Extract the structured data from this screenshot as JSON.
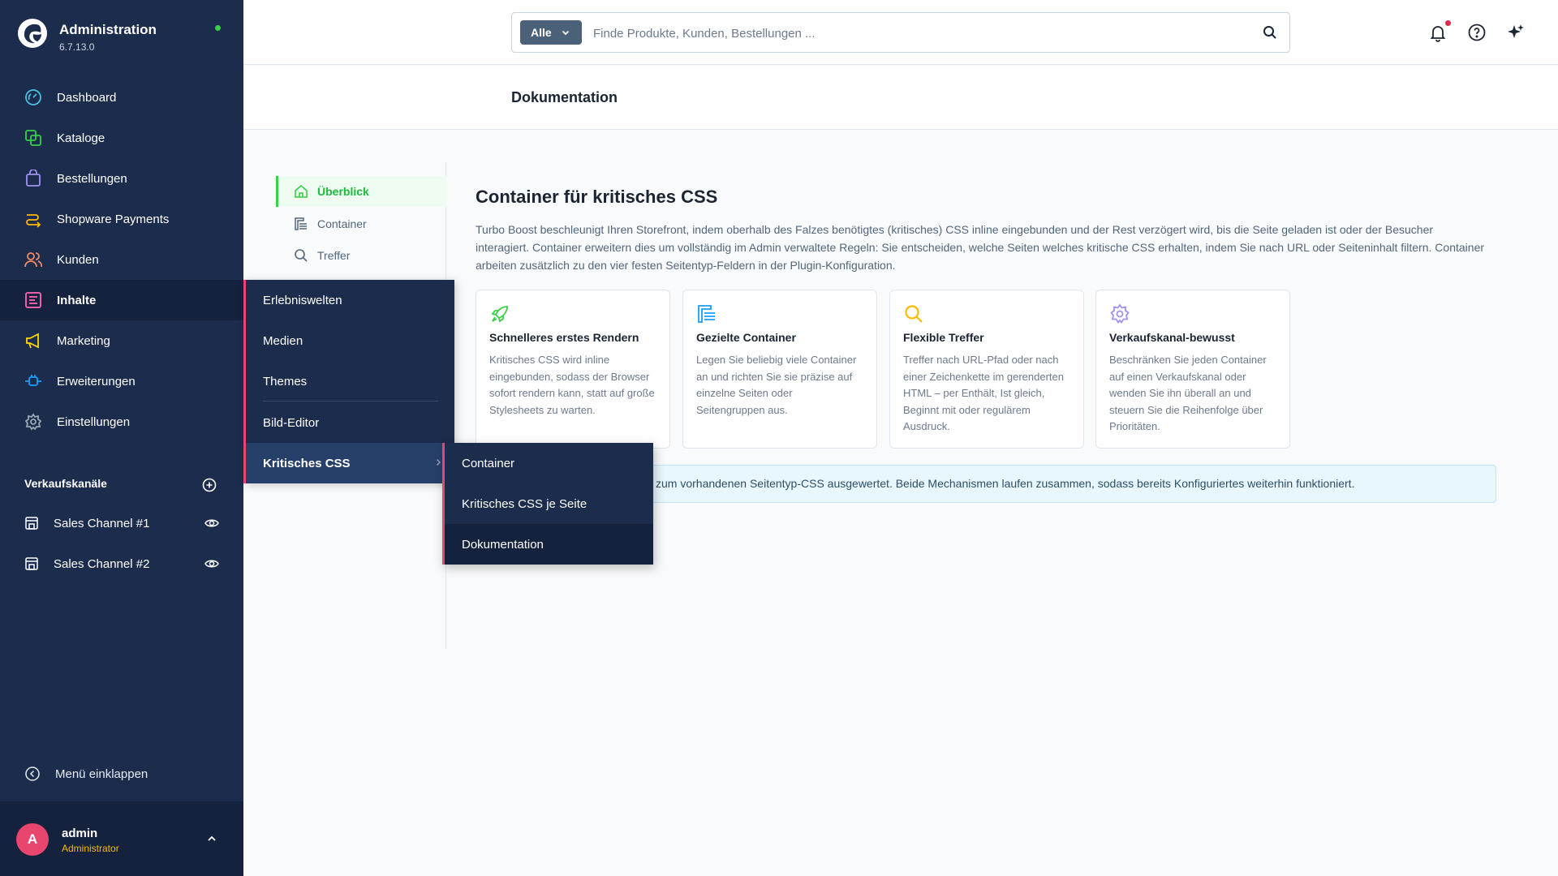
{
  "app": {
    "title": "Administration",
    "version": "6.7.13.0"
  },
  "sidebar": {
    "items": [
      {
        "label": "Dashboard",
        "icon": "dashboard-icon",
        "color": "#4cbfe0"
      },
      {
        "label": "Kataloge",
        "icon": "catalog-icon",
        "color": "#37d046"
      },
      {
        "label": "Bestellungen",
        "icon": "shopping-bag-icon",
        "color": "#a092f0"
      },
      {
        "label": "Shopware Payments",
        "icon": "payment-icon",
        "color": "#ffb900"
      },
      {
        "label": "Kunden",
        "icon": "customers-icon",
        "color": "#f88962"
      },
      {
        "label": "Inhalte",
        "icon": "content-icon",
        "color": "#ff68b4"
      },
      {
        "label": "Marketing",
        "icon": "megaphone-icon",
        "color": "#ffd700"
      },
      {
        "label": "Erweiterungen",
        "icon": "plug-icon",
        "color": "#189eff"
      },
      {
        "label": "Einstellungen",
        "icon": "gear-icon",
        "color": "#9aa8b5"
      }
    ],
    "sales_channels_title": "Verkaufskanäle",
    "sales_channels": [
      {
        "label": "Sales Channel #1"
      },
      {
        "label": "Sales Channel #2"
      }
    ],
    "collapse_label": "Menü einklappen",
    "user": {
      "initial": "A",
      "name": "admin",
      "role": "Administrator"
    }
  },
  "topbar": {
    "search_type": "Alle",
    "search_placeholder": "Finde Produkte, Kunden, Bestellungen ..."
  },
  "page": {
    "title": "Dokumentation"
  },
  "subnav": {
    "items": [
      {
        "label": "Überblick",
        "active": true
      },
      {
        "label": "Container",
        "active": false
      },
      {
        "label": "Treffer",
        "active": false
      }
    ]
  },
  "content": {
    "title": "Container für kritisches CSS",
    "description": "Turbo Boost beschleunigt Ihren Storefront, indem oberhalb des Falzes benötigtes (kritisches) CSS inline eingebunden und der Rest verzögert wird, bis die Seite geladen ist oder der Besucher interagiert. Container erweitern dies um vollständig im Admin verwaltete Regeln: Sie entscheiden, welche Seiten welches kritische CSS erhalten, indem Sie nach URL oder Seiteninhalt filtern. Container arbeiten zusätzlich zu den vier festen Seitentyp-Feldern in der Plugin-Konfiguration.",
    "cards": [
      {
        "title": "Schnelleres erstes Rendern",
        "text": "Kritisches CSS wird inline eingebunden, sodass der Browser sofort rendern kann, statt auf große Stylesheets zu warten.",
        "icon": "rocket-icon",
        "color": "#37d046"
      },
      {
        "title": "Gezielte Container",
        "text": "Legen Sie beliebig viele Container an und richten Sie sie präzise auf einzelne Seiten oder Seitengruppen aus.",
        "icon": "container-icon",
        "color": "#189eff"
      },
      {
        "title": "Flexible Treffer",
        "text": "Treffer nach URL-Pfad oder nach einer Zeichenkette im gerenderten HTML – per Enthält, Ist gleich, Beginnt mit oder regulärem Ausdruck.",
        "icon": "search-icon",
        "color": "#ffb900"
      },
      {
        "title": "Verkaufskanal-bewusst",
        "text": "Beschränken Sie jeden Container auf einen Verkaufskanal oder wenden Sie ihn überall an und steuern Sie die Reihenfolge über Prioritäten.",
        "icon": "gear-icon",
        "color": "#a092f0"
      }
    ],
    "info_text": "zum vorhandenen Seitentyp-CSS ausgewertet. Beide Mechanismen laufen zusammen, sodass bereits Konfiguriertes weiterhin funktioniert."
  },
  "flyout": {
    "items": [
      {
        "label": "Erlebniswelten"
      },
      {
        "label": "Medien"
      },
      {
        "label": "Themes"
      },
      {
        "label": "Bild-Editor"
      },
      {
        "label": "Kritisches CSS"
      }
    ],
    "submenu": [
      {
        "label": "Container"
      },
      {
        "label": "Kritisches CSS je Seite"
      },
      {
        "label": "Dokumentation"
      }
    ]
  }
}
